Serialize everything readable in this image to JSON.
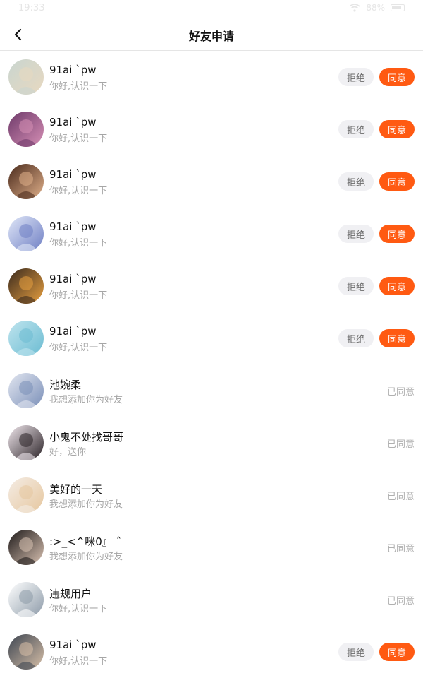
{
  "status_bar": {
    "time": "19:33",
    "battery": "88%"
  },
  "header": {
    "title": "好友申请",
    "back_icon": "chevron-left-icon"
  },
  "actions": {
    "reject_label": "拒绝",
    "accept_label": "同意",
    "accepted_label": "已同意"
  },
  "requests": [
    {
      "name": "91ai `pw",
      "message": "你好,认识一下",
      "status": "pending",
      "avatar_colors": [
        "#c9d6d0",
        "#e8d8c0"
      ]
    },
    {
      "name": "91ai `pw",
      "message": "你好,认识一下",
      "status": "pending",
      "avatar_colors": [
        "#6e3a6a",
        "#d68fb5"
      ]
    },
    {
      "name": "91ai `pw",
      "message": "你好,认识一下",
      "status": "pending",
      "avatar_colors": [
        "#4a2a1c",
        "#e0b08a"
      ]
    },
    {
      "name": "91ai `pw",
      "message": "你好,认识一下",
      "status": "pending",
      "avatar_colors": [
        "#dfe6f7",
        "#6f7fc4"
      ]
    },
    {
      "name": "91ai `pw",
      "message": "你好,认识一下",
      "status": "pending",
      "avatar_colors": [
        "#3a2a1e",
        "#e8a040"
      ]
    },
    {
      "name": "91ai `pw",
      "message": "你好,认识一下",
      "status": "pending",
      "avatar_colors": [
        "#bfe4ee",
        "#6bbcd2"
      ]
    },
    {
      "name": "池婉柔",
      "message": "我想添加你为好友",
      "status": "accepted",
      "avatar_colors": [
        "#e2e6f0",
        "#7a8fb8"
      ]
    },
    {
      "name": "小鬼不处找哥哥",
      "message": "好，送你",
      "status": "accepted",
      "avatar_colors": [
        "#efe6ec",
        "#2a2226"
      ]
    },
    {
      "name": "美好的一天",
      "message": "我想添加你为好友",
      "status": "accepted",
      "avatar_colors": [
        "#f4ece4",
        "#e6c79f"
      ]
    },
    {
      "name": ":>_<^咪0』 ˆ",
      "message": "我想添加你为好友",
      "status": "accepted",
      "avatar_colors": [
        "#1e1a1a",
        "#d9c2b2"
      ]
    },
    {
      "name": "违规用户",
      "message": "你好,认识一下",
      "status": "accepted",
      "avatar_colors": [
        "#ffffff",
        "#8c9aa8"
      ]
    },
    {
      "name": "91ai `pw",
      "message": "你好,认识一下",
      "status": "pending",
      "avatar_colors": [
        "#3e4652",
        "#d8c0a8"
      ]
    }
  ]
}
